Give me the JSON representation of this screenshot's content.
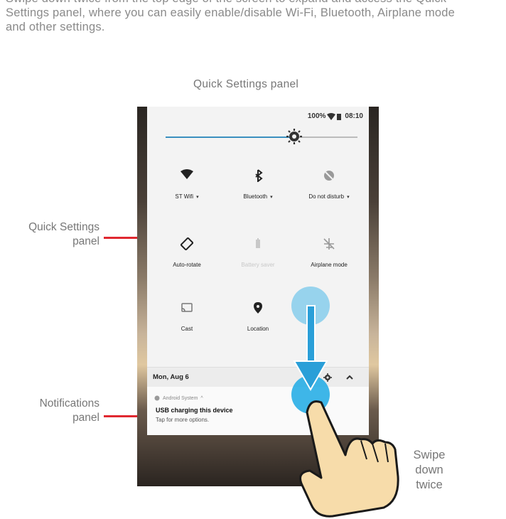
{
  "intro": {
    "line1": "Swipe down twice from the top edge of the screen to expand and access the Quick",
    "line2": "Settings panel, where you can easily enable/disable Wi-Fi, Bluetooth, Airplane mode",
    "line3": "and other settings."
  },
  "heading": "Quick Settings panel",
  "callouts": {
    "quick_settings": {
      "line1": "Quick Settings",
      "line2": "panel"
    },
    "notifications": {
      "line1": "Notifications",
      "line2": "panel"
    },
    "swipe": {
      "line1": "Swipe",
      "line2": "down",
      "line3": "twice"
    }
  },
  "status_bar": {
    "battery_percent": "100%",
    "time": "08:10"
  },
  "brightness_level": 0.67,
  "tiles": [
    {
      "label": "ST Wifi",
      "icon": "wifi-icon",
      "has_dropdown": true,
      "dim": false
    },
    {
      "label": "Bluetooth",
      "icon": "bluetooth-icon",
      "has_dropdown": true,
      "dim": false
    },
    {
      "label": "Do not disturb",
      "icon": "do-not-disturb-icon",
      "has_dropdown": true,
      "dim": false
    },
    {
      "label": "Auto-rotate",
      "icon": "auto-rotate-icon",
      "has_dropdown": false,
      "dim": false
    },
    {
      "label": "Battery saver",
      "icon": "battery-icon",
      "has_dropdown": false,
      "dim": true
    },
    {
      "label": "Airplane mode",
      "icon": "airplane-icon",
      "has_dropdown": false,
      "dim": false
    },
    {
      "label": "Cast",
      "icon": "cast-icon",
      "has_dropdown": false,
      "dim": false
    },
    {
      "label": "Location",
      "icon": "location-icon",
      "has_dropdown": false,
      "dim": false
    }
  ],
  "notifications": {
    "date": "Mon, Aug 6",
    "card": {
      "source": "Android System",
      "title": "USB charging this device",
      "subtitle": "Tap for more options."
    }
  },
  "colors": {
    "accent": "#3a8fbf",
    "callout_line": "#e02830",
    "touch_circle": "#29aee6",
    "arrow": "#2a9fd8",
    "hand_fill": "#f7dcaa",
    "hand_stroke": "#1a1a1a"
  }
}
